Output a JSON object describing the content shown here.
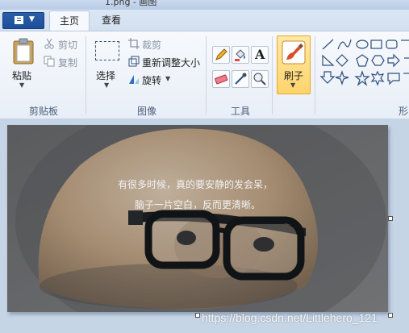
{
  "window": {
    "title_fragment": "1.png - 画图"
  },
  "tabs": [
    {
      "label": "主页"
    },
    {
      "label": "查看"
    }
  ],
  "clipboard": {
    "paste": "粘贴",
    "cut": "剪切",
    "copy": "复制",
    "group": "剪贴板"
  },
  "image": {
    "select": "选择",
    "crop": "裁剪",
    "resize": "重新调整大小",
    "rotate": "旋转",
    "group": "图像"
  },
  "tools": {
    "group": "工具"
  },
  "brushes": {
    "label": "刷子"
  },
  "shapes": {
    "group_partial": "形"
  },
  "photo": {
    "caption_line1": "有很多时候，真的要安静的发会呆，",
    "caption_line2": "脑子一片空白，反而更清晰。"
  },
  "watermark": "https://blog.csdn.net/Littlehero_121",
  "colors": {
    "accent": "#1b4f9a",
    "ribbon_bg": "#f0f4fa",
    "brush_highlight": "#ffd36b",
    "canvas_bg": "#c6d5e6"
  }
}
